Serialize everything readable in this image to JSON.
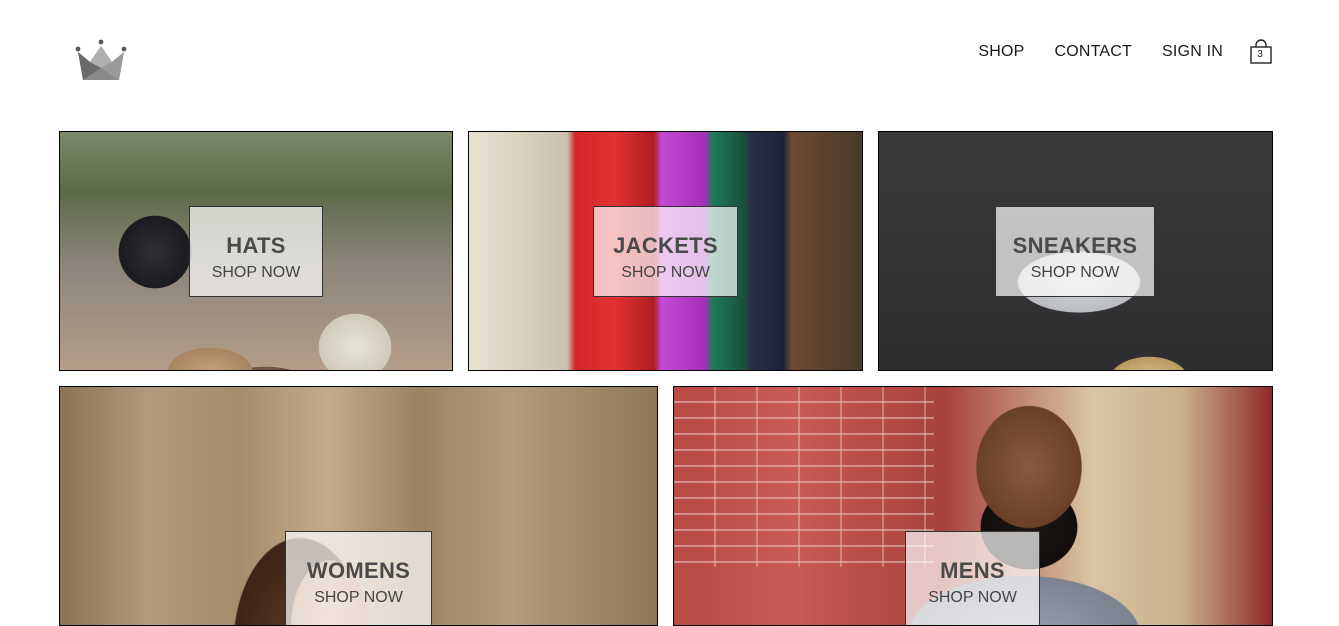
{
  "header": {
    "logo_icon": "crown-icon",
    "nav": {
      "shop": "SHOP",
      "contact": "CONTACT",
      "sign_in": "SIGN IN"
    },
    "cart": {
      "icon": "shopping-bag-icon",
      "count": "3"
    }
  },
  "directory": [
    {
      "title": "HATS",
      "cta": "SHOP NOW"
    },
    {
      "title": "JACKETS",
      "cta": "SHOP NOW"
    },
    {
      "title": "SNEAKERS",
      "cta": "SHOP NOW"
    },
    {
      "title": "WOMENS",
      "cta": "SHOP NOW"
    },
    {
      "title": "MENS",
      "cta": "SHOP NOW"
    }
  ]
}
